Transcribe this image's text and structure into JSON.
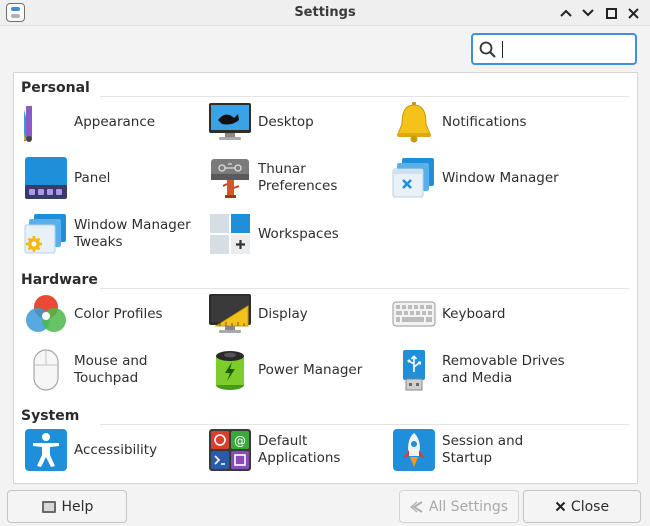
{
  "window": {
    "title": "Settings"
  },
  "search": {
    "value": "",
    "placeholder": ""
  },
  "sections": {
    "personal": "Personal",
    "hardware": "Hardware",
    "system": "System"
  },
  "items": {
    "appearance": "Appearance",
    "desktop": "Desktop",
    "notifications": "Notifications",
    "panel": "Panel",
    "thunar_l1": "Thunar Preferences",
    "window_manager": "Window Manager",
    "wm_tweaks_l1": "Window Manager",
    "wm_tweaks_l2": "Tweaks",
    "workspaces": "Workspaces",
    "color_profiles": "Color Profiles",
    "display": "Display",
    "keyboard": "Keyboard",
    "mouse_l1": "Mouse and",
    "mouse_l2": "Touchpad",
    "power_manager": "Power Manager",
    "removable_l1": "Removable Drives",
    "removable_l2": "and Media",
    "accessibility": "Accessibility",
    "default_apps_l1": "Default",
    "default_apps_l2": "Applications",
    "session_l1": "Session and",
    "session_l2": "Startup"
  },
  "buttons": {
    "help": "Help",
    "all_settings": "All Settings",
    "close": "Close"
  },
  "colors": {
    "accent": "#3c8ee6",
    "brand_blue": "#1e8fd8"
  }
}
